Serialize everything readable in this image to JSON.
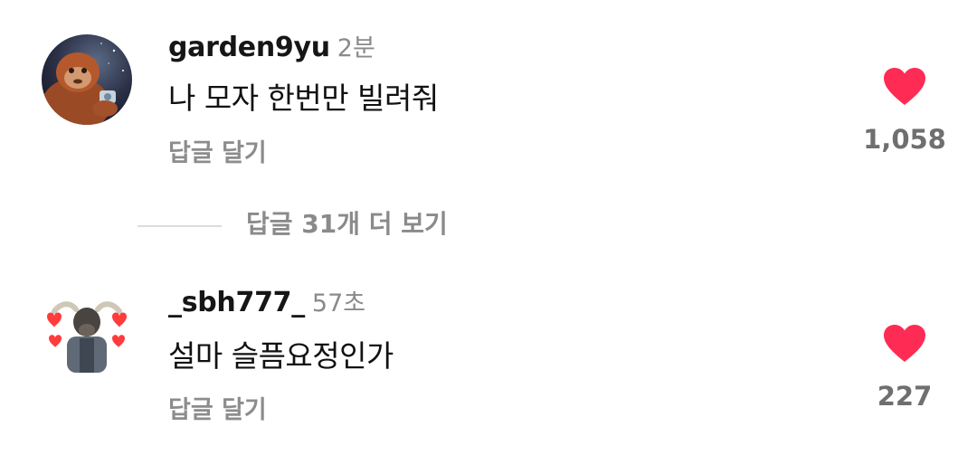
{
  "comments": [
    {
      "username": "garden9yu",
      "time": "2분",
      "text": "나 모자 한번만 빌려줘",
      "reply_label": "답글 달기",
      "like_count": "1,058",
      "avatar": "orangutan-avatar"
    },
    {
      "username": "_sbh777_",
      "time": "57초",
      "text": "설마 슬픔요정인가",
      "reply_label": "답글 달기",
      "like_count": "227",
      "avatar": "buffalo-with-hearts-avatar"
    }
  ],
  "view_replies": {
    "label": "답글 31개 더 보기"
  },
  "colors": {
    "heart": "#fe2c55",
    "muted_text": "#8a8a8a",
    "primary_text": "#111111"
  }
}
